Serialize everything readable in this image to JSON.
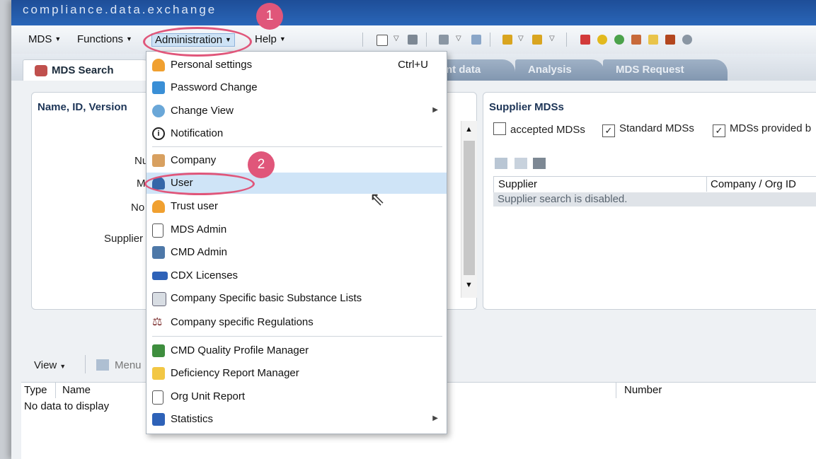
{
  "app": {
    "brand": "compliance.data.exchange"
  },
  "menubar": {
    "items": [
      {
        "label": "MDS"
      },
      {
        "label": "Functions"
      },
      {
        "label": "Administration"
      },
      {
        "label": "Help"
      }
    ]
  },
  "tabs": [
    {
      "label": "MDS Search",
      "active": true
    },
    {
      "label": "nt data"
    },
    {
      "label": "Analysis"
    },
    {
      "label": "MDS Request"
    }
  ],
  "search_panel": {
    "title": "Name, ID, Version",
    "field_labels": [
      "Nu",
      "M",
      "No",
      "Supplier"
    ]
  },
  "supplier_panel": {
    "title": "Supplier MDSs",
    "checkboxes": [
      {
        "label": "accepted MDSs",
        "checked": false
      },
      {
        "label": "Standard MDSs",
        "checked": true
      },
      {
        "label": "MDSs provided b",
        "checked": true
      }
    ],
    "table": {
      "columns": [
        "Supplier",
        "Company / Org ID"
      ],
      "empty_text": "Supplier search is disabled."
    }
  },
  "bottom": {
    "view_label": "View",
    "menu_label": "Menu",
    "columns": [
      "Type",
      "Name",
      "Number"
    ],
    "empty_text": "No data to display"
  },
  "admin_menu": {
    "items": [
      {
        "label": "Personal settings",
        "shortcut": "Ctrl+U",
        "icon": "person-icon",
        "color": "#f0a030"
      },
      {
        "label": "Password Change",
        "icon": "key-users-icon",
        "color": "#3a8fd6"
      },
      {
        "label": "Change View",
        "icon": "gear-icon",
        "color": "#6aa7d8",
        "submenu": true
      },
      {
        "label": "Notification",
        "icon": "info-icon",
        "color": "#ffffff"
      },
      {
        "label": "Company",
        "icon": "building-icon",
        "color": "#d8a060"
      },
      {
        "label": "User",
        "icon": "user-icon",
        "color": "#3566a8",
        "highlighted": true
      },
      {
        "label": "Trust user",
        "icon": "trust-user-icon",
        "color": "#f0a030"
      },
      {
        "label": "MDS Admin",
        "icon": "document-icon",
        "color": "#cfd6de"
      },
      {
        "label": "CMD Admin",
        "icon": "contact-card-icon",
        "color": "#4e78a8"
      },
      {
        "label": "CDX Licenses",
        "icon": "card-icon",
        "color": "#2e62b8"
      },
      {
        "label": "Company Specific basic Substance Lists",
        "icon": "list-icon",
        "color": "#d8dde3"
      },
      {
        "label": "Company specific Regulations",
        "icon": "gavel-icon",
        "color": "#7a2a2a"
      },
      {
        "label": "CMD Quality Profile Manager",
        "icon": "quality-check-icon",
        "color": "#3e8e3e"
      },
      {
        "label": "Deficiency Report Manager",
        "icon": "report-icon",
        "color": "#f2c744"
      },
      {
        "label": "Org Unit Report",
        "icon": "document-icon",
        "color": "#cfd6de"
      },
      {
        "label": "Statistics",
        "icon": "bar-chart-icon",
        "color": "#2e62b8",
        "submenu": true
      }
    ]
  },
  "annotations": {
    "step1": "1",
    "step2": "2"
  }
}
